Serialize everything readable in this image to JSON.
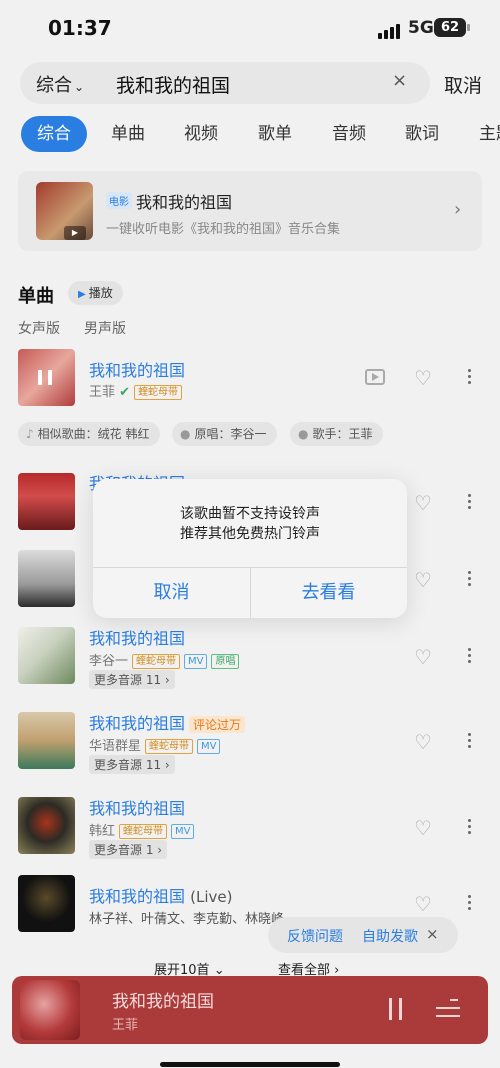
{
  "status_bar": {
    "time": "01:37",
    "network": "5G",
    "battery": "62"
  },
  "search": {
    "scope": "综合",
    "query": "我和我的祖国",
    "clear": "×",
    "cancel": "取消"
  },
  "tabs": [
    "综合",
    "单曲",
    "视频",
    "歌单",
    "音频",
    "歌词",
    "主题"
  ],
  "banner": {
    "tag": "电影",
    "title": "我和我的祖国",
    "subtitle": "一键收听电影《我和我的祖国》音乐合集"
  },
  "section": {
    "title": "单曲",
    "play_all": "播放",
    "filter_female": "女声版",
    "filter_male": "男声版"
  },
  "songs": [
    {
      "title": "我和我的祖国",
      "artist": "王菲",
      "badge": "蝰蛇母带"
    },
    {
      "title": "我和我的祖国",
      "artist": ""
    },
    {
      "title": "",
      "artist": ""
    },
    {
      "title": "我和我的祖国",
      "artist": "李谷一",
      "badge": "蝰蛇母带",
      "mv": "MV",
      "original": "原唱",
      "more": "更多音源 11"
    },
    {
      "title": "我和我的祖国",
      "hot": "评论过万",
      "artist": "华语群星",
      "badge": "蝰蛇母带",
      "mv": "MV",
      "more": "更多音源 11"
    },
    {
      "title": "我和我的祖国",
      "artist": "韩红",
      "badge": "蝰蛇母带",
      "mv": "MV",
      "more": "更多音源 1"
    },
    {
      "title": "我和我的祖国",
      "live": "(Live)",
      "artist": "林子祥、叶蒨文、李克勤、林晓峰、..."
    }
  ],
  "chips": {
    "similar": "相似歌曲：绒花 韩红",
    "original": "原唱：李谷一",
    "singer": "歌手：王菲"
  },
  "dialog": {
    "line1": "该歌曲暂不支持设铃声",
    "line2": "推荐其他免费热门铃声",
    "cancel": "取消",
    "confirm": "去看看"
  },
  "footer": {
    "expand": "展开10首",
    "view_all": "查看全部"
  },
  "feedback": {
    "report": "反馈问题",
    "request": "自助发歌",
    "close": "×"
  },
  "player": {
    "title": "我和我的祖国",
    "artist": "王菲"
  },
  "colors": {
    "accent": "#2a7de1",
    "player_bg": "#ab3a3a"
  }
}
